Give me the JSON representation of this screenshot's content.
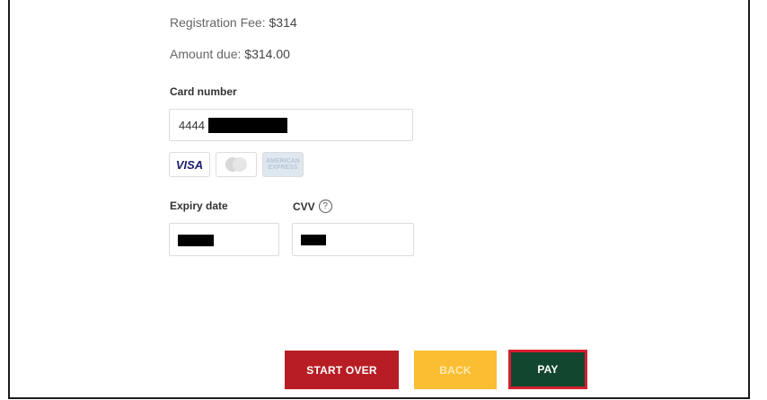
{
  "summary": {
    "fee_label": "Registration Fee:",
    "fee_value": "$314",
    "due_label": "Amount due:",
    "due_value": "$314.00"
  },
  "card": {
    "label": "Card number",
    "prefix": "4444"
  },
  "brands": {
    "visa": "VISA",
    "amex": "AMERICAN EXPRESS"
  },
  "expiry": {
    "label": "Expiry date"
  },
  "cvv": {
    "label": "CVV",
    "help": "?"
  },
  "buttons": {
    "start_over": "START OVER",
    "back": "BACK",
    "pay": "PAY"
  },
  "colors": {
    "start_over": "#b81d24",
    "back": "#fbbd32",
    "pay": "#13462e",
    "highlight": "#d51f30"
  }
}
